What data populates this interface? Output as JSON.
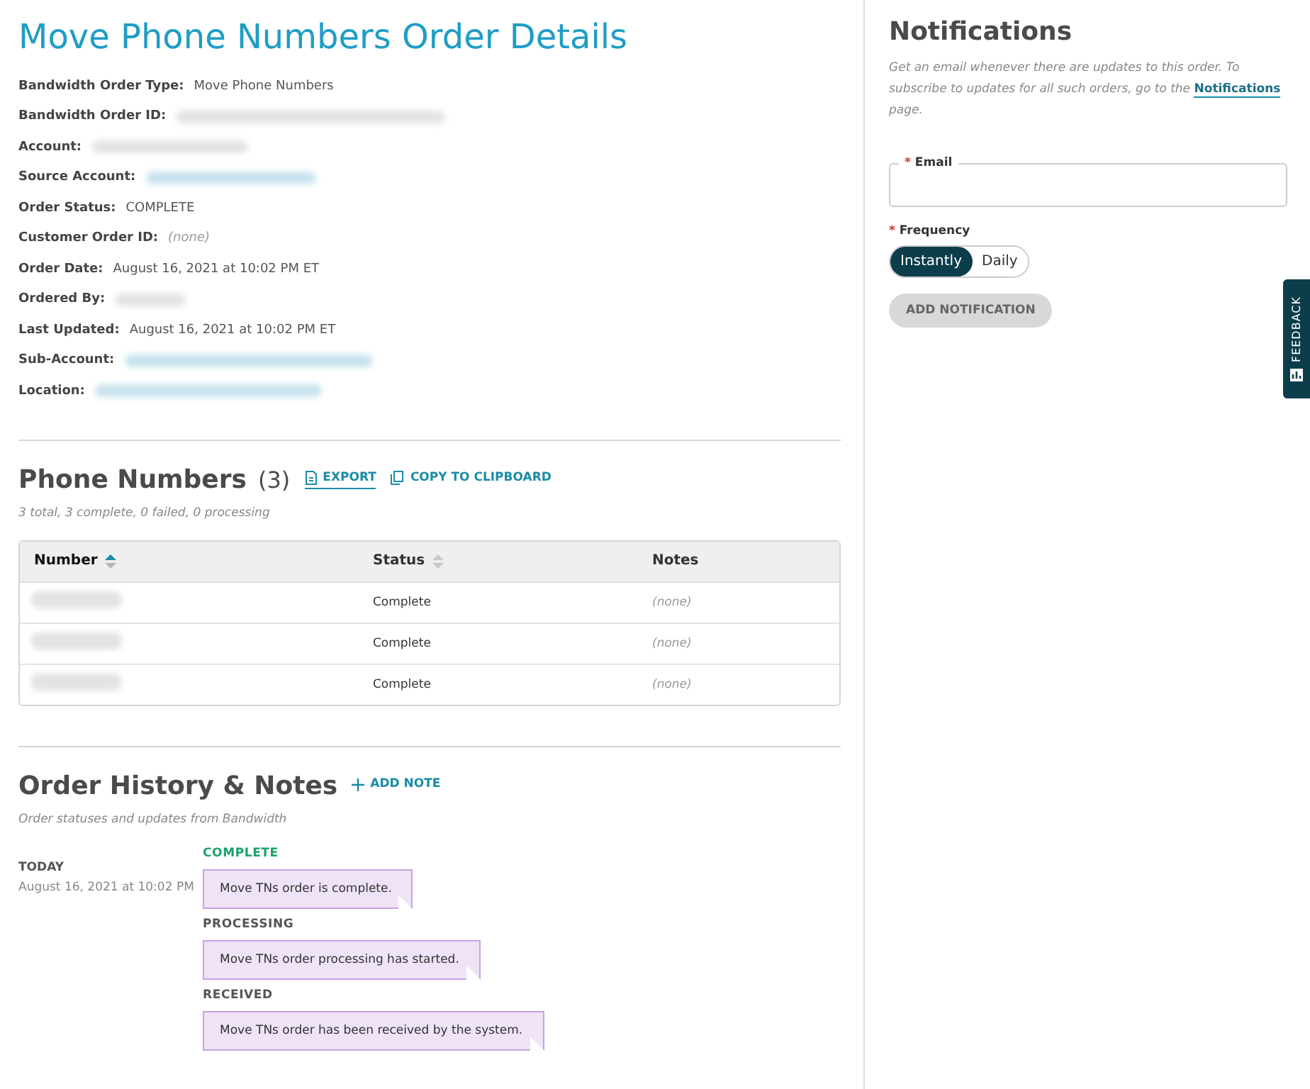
{
  "title": "Move Phone Numbers Order Details",
  "details": [
    {
      "label": "Bandwidth Order Type:",
      "kind": "text",
      "value": "Move Phone Numbers"
    },
    {
      "label": "Bandwidth Order ID:",
      "kind": "redacted"
    },
    {
      "label": "Account:",
      "kind": "redacted"
    },
    {
      "label": "Source Account:",
      "kind": "redacted-link"
    },
    {
      "label": "Order Status:",
      "kind": "text",
      "value": "COMPLETE"
    },
    {
      "label": "Customer Order ID:",
      "kind": "none",
      "value": "(none)"
    },
    {
      "label": "Order Date:",
      "kind": "text",
      "value": "August 16, 2021 at 10:02 PM ET"
    },
    {
      "label": "Ordered By:",
      "kind": "redacted"
    },
    {
      "label": "Last Updated:",
      "kind": "text",
      "value": "August 16, 2021 at 10:02 PM ET"
    },
    {
      "label": "Sub-Account:",
      "kind": "redacted-link"
    },
    {
      "label": "Location:",
      "kind": "redacted-link"
    }
  ],
  "phone_numbers": {
    "heading": "Phone Numbers",
    "count": "(3)",
    "export": "EXPORT",
    "copy": "COPY TO CLIPBOARD",
    "summary": "3 total, 3 complete, 0 failed, 0 processing",
    "columns": [
      {
        "label": "Number",
        "sortable": true,
        "sorted": true
      },
      {
        "label": "Status",
        "sortable": true,
        "sorted": false
      },
      {
        "label": "Notes",
        "sortable": false,
        "sorted": false
      }
    ],
    "rows": [
      {
        "kind": "redacted",
        "status": "Complete",
        "notes": "(none)"
      },
      {
        "kind": "redacted",
        "status": "Complete",
        "notes": "(none)"
      },
      {
        "kind": "redacted",
        "status": "Complete",
        "notes": "(none)"
      }
    ]
  },
  "history": {
    "heading": "Order History & Notes",
    "add_note": "ADD NOTE",
    "subtitle": "Order statuses and updates from Bandwidth",
    "day": "TODAY",
    "time": "August 16, 2021 at 10:02 PM",
    "entries": [
      {
        "status": "COMPLETE",
        "color": "#1aa36b",
        "note": "Move TNs order is complete."
      },
      {
        "status": "PROCESSING",
        "color": "#555555",
        "note": "Move TNs order processing has started."
      },
      {
        "status": "RECEIVED",
        "color": "#555555",
        "note": "Move TNs order has been received by the system."
      }
    ]
  },
  "notifications": {
    "heading": "Notifications",
    "description": "Get an email whenever there are updates to this order. To subscribe to updates for all such orders, go to the",
    "link": "Notifications",
    "description_end": "page.",
    "required_mark": "*",
    "email_label": "Email",
    "frequency_label": "Frequency",
    "frequency": [
      {
        "label": "Instantly",
        "selected": true
      },
      {
        "label": "Daily",
        "selected": false
      }
    ],
    "add_button": {
      "label": "ADD NOTIFICATION",
      "disabled": true
    }
  },
  "feedback": "FEEDBACK"
}
